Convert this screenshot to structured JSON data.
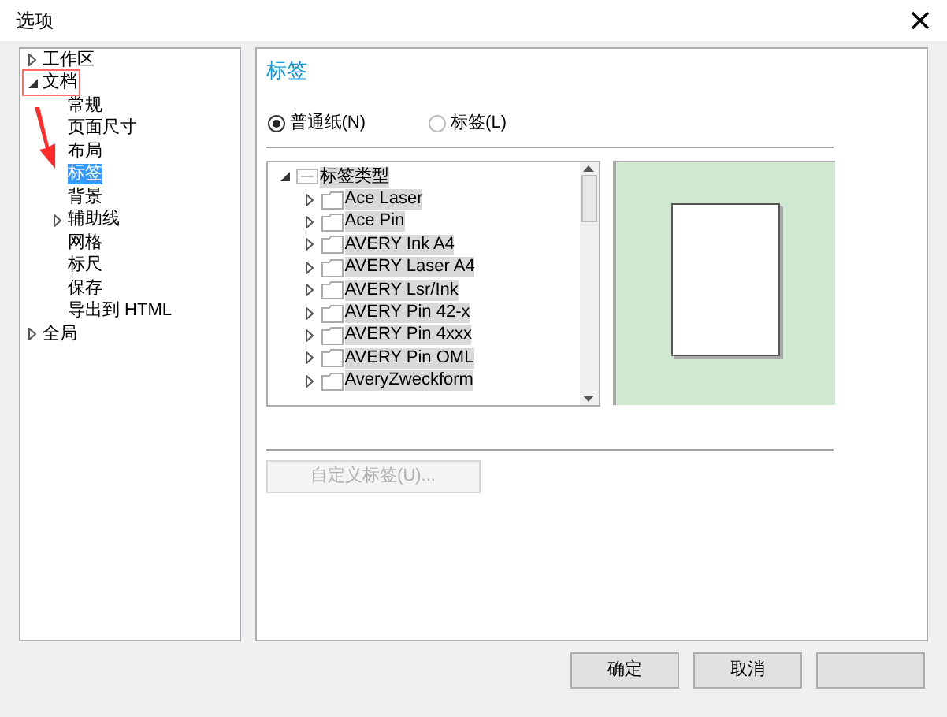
{
  "window": {
    "title": "选项"
  },
  "sidebar": {
    "items": [
      {
        "label": "工作区",
        "expanded": false,
        "selected": false,
        "expandable": true
      },
      {
        "label": "文档",
        "expanded": true,
        "selected": false,
        "expandable": true,
        "children": [
          {
            "label": "常规",
            "selected": false
          },
          {
            "label": "页面尺寸",
            "selected": false
          },
          {
            "label": "布局",
            "selected": false
          },
          {
            "label": "标签",
            "selected": true
          },
          {
            "label": "背景",
            "selected": false
          },
          {
            "label": "辅助线",
            "selected": false,
            "expanded": false,
            "expandable": true
          },
          {
            "label": "网格",
            "selected": false
          },
          {
            "label": "标尺",
            "selected": false
          },
          {
            "label": "保存",
            "selected": false
          },
          {
            "label": "导出到 HTML",
            "selected": false
          }
        ]
      },
      {
        "label": "全局",
        "expanded": false,
        "selected": false,
        "expandable": true
      }
    ]
  },
  "page": {
    "title": "标签",
    "radios": [
      {
        "label": "普通纸(N)",
        "selected": true
      },
      {
        "label": "标签(L)",
        "selected": false
      }
    ],
    "label_types": {
      "label": "标签类型",
      "expanded": true,
      "children": [
        {
          "label": "Ace Laser",
          "expanded": false
        },
        {
          "label": "Ace Pin",
          "expanded": false
        },
        {
          "label": "AVERY Ink A4",
          "expanded": false
        },
        {
          "label": "AVERY Laser A4",
          "expanded": false
        },
        {
          "label": "AVERY Lsr/Ink",
          "expanded": false
        },
        {
          "label": "AVERY Pin 42-x",
          "expanded": false
        },
        {
          "label": "AVERY Pin 4xxx",
          "expanded": false
        },
        {
          "label": "AVERY Pin OML",
          "expanded": false
        },
        {
          "label": "AveryZweckform",
          "expanded": false
        }
      ]
    },
    "custom_button": {
      "label": "自定义标签(U)...",
      "disabled": true
    }
  },
  "buttons": [
    {
      "label": "确定"
    },
    {
      "label": "取消"
    }
  ]
}
